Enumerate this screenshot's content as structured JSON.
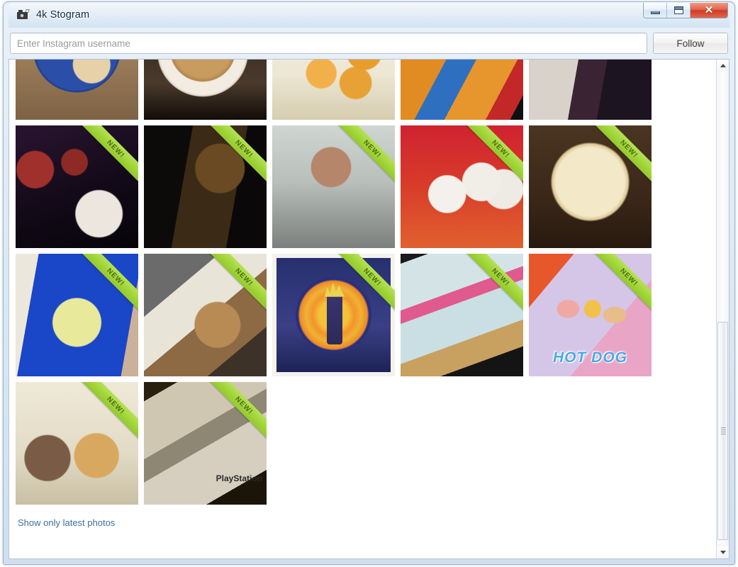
{
  "window": {
    "title": "4k Stogram",
    "icon": "camera-icon",
    "controls": {
      "minimize": "minimize-button",
      "maximize": "maximize-button",
      "close_glyph": "✕"
    }
  },
  "toolbar": {
    "search_placeholder": "Enter Instagram username",
    "search_value": "",
    "follow_label": "Follow"
  },
  "footer": {
    "link_label": "Show only latest photos"
  },
  "gallery": {
    "ribbon_label": "NEW!",
    "ribbon_color": "#a3d63b",
    "accent_link_color": "#3d6f9e",
    "columns": 5,
    "rows": [
      {
        "clipped": true,
        "items": [
          {
            "alt": "plate-of-cookies",
            "style": "ph-cookies",
            "ribbon": false,
            "framed": false
          },
          {
            "alt": "pie-on-plate",
            "style": "ph-pie",
            "ribbon": false,
            "framed": false
          },
          {
            "alt": "fried-nuggets",
            "style": "ph-nuggets",
            "ribbon": false,
            "framed": false
          },
          {
            "alt": "person-in-orange-vest",
            "style": "ph-vest",
            "ribbon": false,
            "framed": false
          },
          {
            "alt": "person-shoulder",
            "style": "ph-shoulder",
            "ribbon": false,
            "framed": false
          }
        ]
      },
      {
        "clipped": false,
        "items": [
          {
            "alt": "drinks-and-coffee-cup",
            "style": "ph-drinks",
            "ribbon": true,
            "framed": false
          },
          {
            "alt": "dark-cat-photo",
            "style": "ph-darkcat",
            "ribbon": true,
            "framed": false
          },
          {
            "alt": "man-selfie-indoors",
            "style": "ph-selfieman",
            "ribbon": true,
            "framed": false
          },
          {
            "alt": "styrofoam-coffee-cups",
            "style": "ph-cups",
            "ribbon": true,
            "framed": false
          },
          {
            "alt": "scoop-of-ice-cream",
            "style": "ph-icecream",
            "ribbon": true,
            "framed": false
          }
        ]
      },
      {
        "clipped": false,
        "items": [
          {
            "alt": "blue-vault-tec-tshirt",
            "style": "ph-bluetee",
            "ribbon": true,
            "framed": false
          },
          {
            "alt": "dog-on-bed",
            "style": "ph-dogbed",
            "ribbon": true,
            "framed": false
          },
          {
            "alt": "dragon-ball-z-artwork",
            "style": "ph-dbz",
            "ribbon": true,
            "framed": true
          },
          {
            "alt": "person-lying-in-bed",
            "style": "ph-bedlegs",
            "ribbon": true,
            "framed": false
          },
          {
            "alt": "hot-dog-packaging",
            "style": "ph-hotdog",
            "ribbon": true,
            "framed": false,
            "caption": "HOT DOG"
          }
        ]
      },
      {
        "clipped": false,
        "items": [
          {
            "alt": "man-with-chihuahua",
            "style": "ph-mandog",
            "ribbon": true,
            "framed": false
          },
          {
            "alt": "playstation-game-cases",
            "style": "ph-ps",
            "ribbon": true,
            "framed": false,
            "caption": "PlayStation"
          }
        ]
      }
    ]
  },
  "scrollbar": {
    "up_arrow": "scroll-up-arrow",
    "down_arrow": "scroll-down-arrow",
    "thumb": "scroll-thumb"
  }
}
